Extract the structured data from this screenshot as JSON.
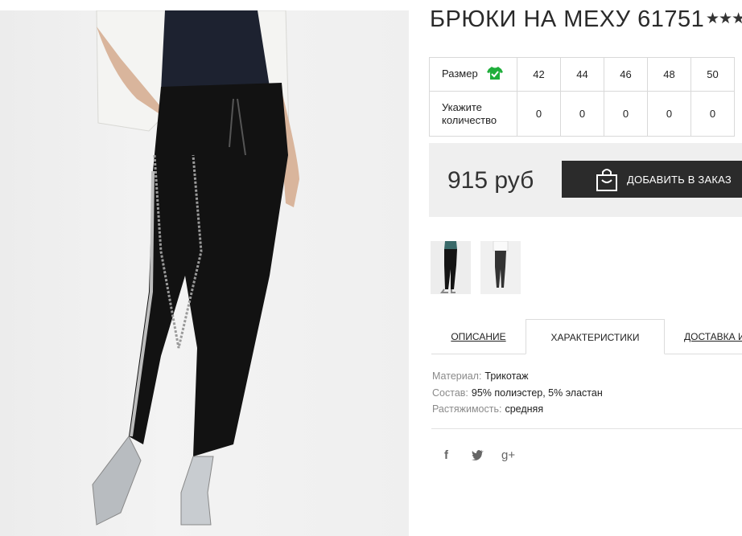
{
  "product": {
    "title": "БРЮКИ НА МЕХУ 61751",
    "rating_stars": "★★★"
  },
  "size_table": {
    "size_label": "Размер",
    "qty_label_line1": "Укажите",
    "qty_label_line2": "количество",
    "sizes": [
      "42",
      "44",
      "46",
      "48",
      "50"
    ],
    "quantities": [
      "0",
      "0",
      "0",
      "0",
      "0"
    ],
    "icon": "tshirt-check-icon",
    "icon_color": "#1fae3b"
  },
  "purchase": {
    "price": "915 руб",
    "add_button_label": "ДОБАВИТЬ В ЗАКАЗ",
    "button_icon": "shopping-bag-icon"
  },
  "tabs": [
    {
      "label": "ОПИСАНИЕ"
    },
    {
      "label": "ХАРАКТЕРИСТИКИ",
      "active": true
    },
    {
      "label": "ДОСТАВКА И"
    }
  ],
  "characteristics": [
    {
      "key": "Материал:",
      "value": "Трикотаж"
    },
    {
      "key": "Состав:",
      "value": "95% полиэстер, 5% эластан"
    },
    {
      "key": "Растяжимость:",
      "value": "средняя"
    }
  ],
  "social": {
    "facebook": "f",
    "twitter": "🐦",
    "googleplus": "g+"
  },
  "colors": {
    "button_bg": "#2b2b2b",
    "price_bar_bg": "#efefef",
    "accent_green": "#1fae3b"
  }
}
